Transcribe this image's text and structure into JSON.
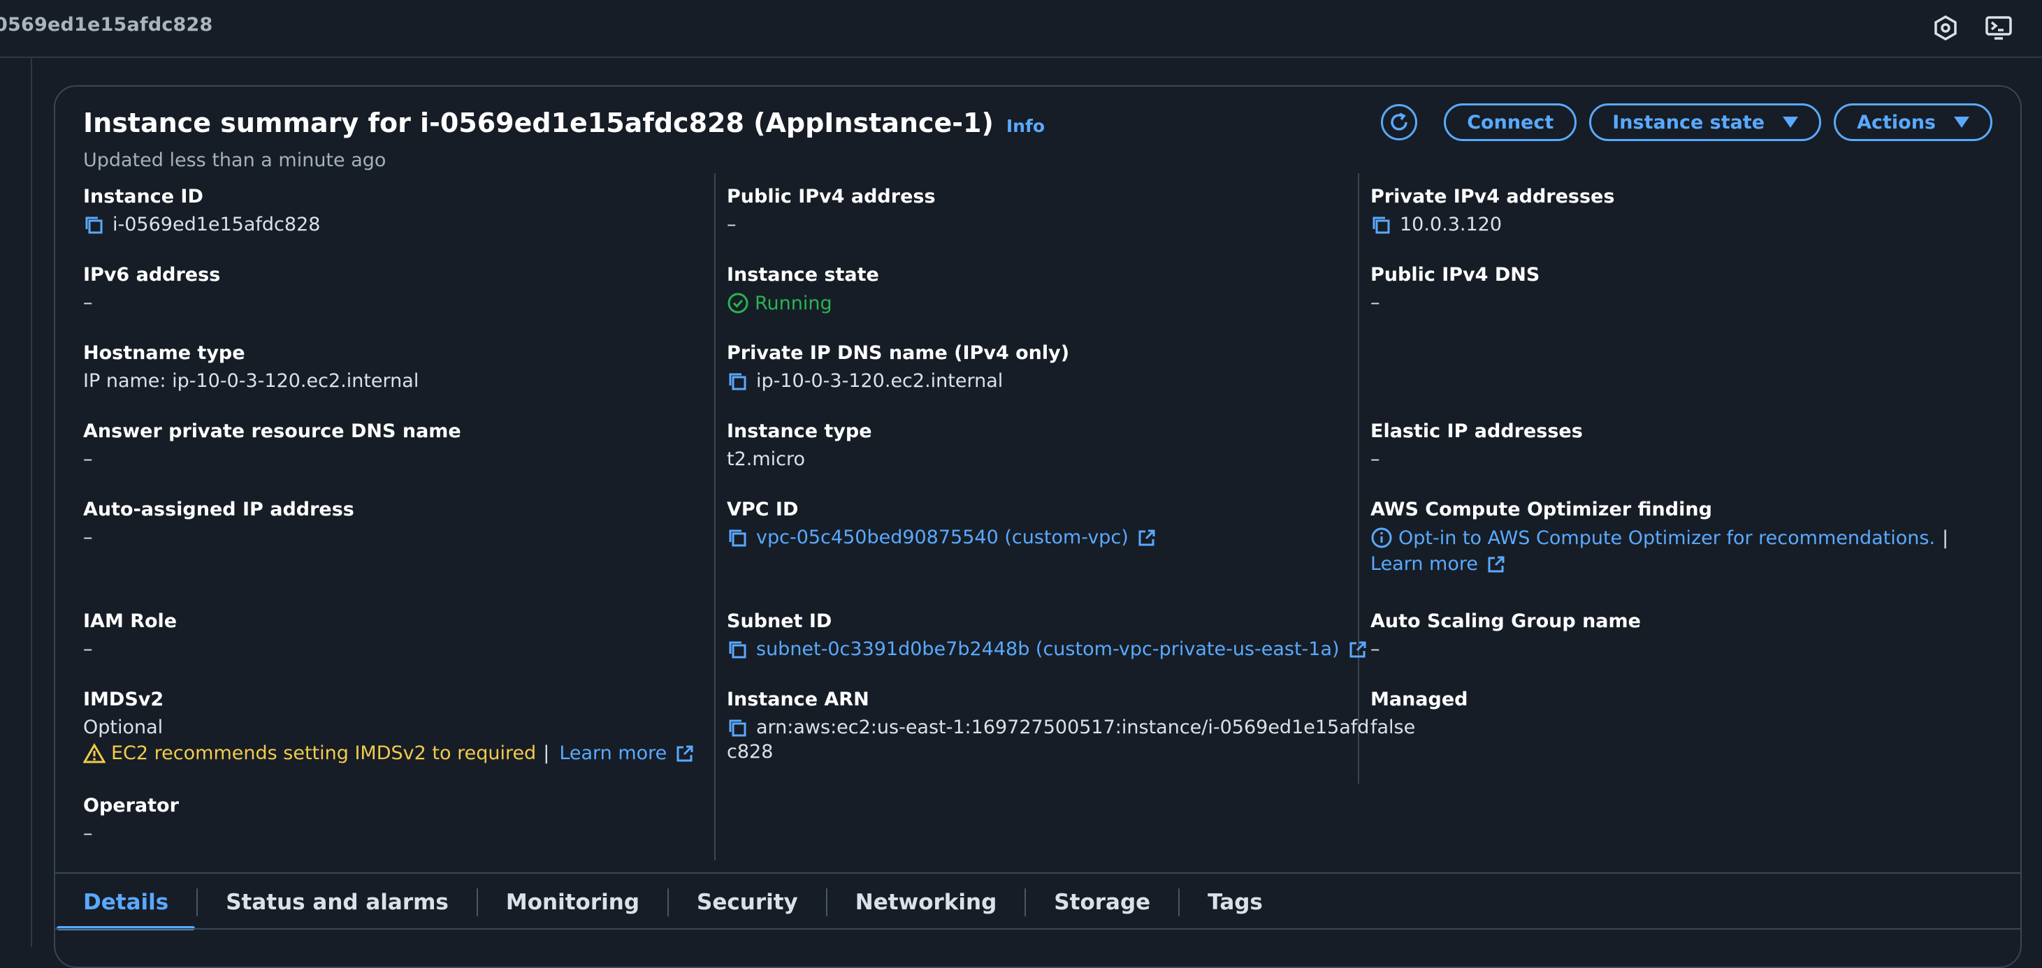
{
  "topbar": {
    "title": "0569ed1e15afdc828"
  },
  "summary": {
    "title": "Instance summary for i-0569ed1e15afdc828 (AppInstance-1)",
    "info": "Info",
    "updated": "Updated less than a minute ago",
    "buttons": {
      "connect": "Connect",
      "instance_state": "Instance state",
      "actions": "Actions"
    }
  },
  "col1": {
    "instance_id": {
      "label": "Instance ID",
      "value": "i-0569ed1e15afdc828"
    },
    "ipv6": {
      "label": "IPv6 address",
      "value": "–"
    },
    "hostname_type": {
      "label": "Hostname type",
      "value": "IP name: ip-10-0-3-120.ec2.internal"
    },
    "answer_dns": {
      "label": "Answer private resource DNS name",
      "value": "–"
    },
    "auto_ip": {
      "label": "Auto-assigned IP address",
      "value": "–"
    },
    "iam_role": {
      "label": "IAM Role",
      "value": "–"
    },
    "imdsv2": {
      "label": "IMDSv2",
      "value": "Optional",
      "warning": "EC2 recommends setting IMDSv2 to required",
      "learn_more": "Learn more"
    },
    "operator": {
      "label": "Operator",
      "value": "–"
    }
  },
  "col2": {
    "public_ipv4": {
      "label": "Public IPv4 address",
      "value": "–"
    },
    "instance_state": {
      "label": "Instance state",
      "value": "Running"
    },
    "private_dns": {
      "label": "Private IP DNS name (IPv4 only)",
      "value": "ip-10-0-3-120.ec2.internal"
    },
    "instance_type": {
      "label": "Instance type",
      "value": "t2.micro"
    },
    "vpc_id": {
      "label": "VPC ID",
      "value": "vpc-05c450bed90875540 (custom-vpc)"
    },
    "subnet_id": {
      "label": "Subnet ID",
      "value": "subnet-0c3391d0be7b2448b (custom-vpc-private-us-east-1a)"
    },
    "arn": {
      "label": "Instance ARN",
      "value_line1": "arn:aws:ec2:us-east-1:169727500517:instance/i-0569ed1e15afd",
      "value_line2": "c828"
    }
  },
  "col3": {
    "private_ipv4": {
      "label": "Private IPv4 addresses",
      "value": "10.0.3.120"
    },
    "public_dns": {
      "label": "Public IPv4 DNS",
      "value": "–"
    },
    "elastic_ip": {
      "label": "Elastic IP addresses",
      "value": "–"
    },
    "optimizer": {
      "label": "AWS Compute Optimizer finding",
      "link": "Opt-in to AWS Compute Optimizer for recommendations.",
      "sep": "|",
      "learn_more": "Learn more"
    },
    "asg": {
      "label": "Auto Scaling Group name",
      "value": "–"
    },
    "managed": {
      "label": "Managed",
      "value": "false"
    }
  },
  "tabs": [
    "Details",
    "Status and alarms",
    "Monitoring",
    "Security",
    "Networking",
    "Storage",
    "Tags"
  ],
  "colors": {
    "background": "#161d26",
    "accent": "#5aa9ff",
    "success": "#29b352",
    "warning": "#f3cb4a"
  }
}
